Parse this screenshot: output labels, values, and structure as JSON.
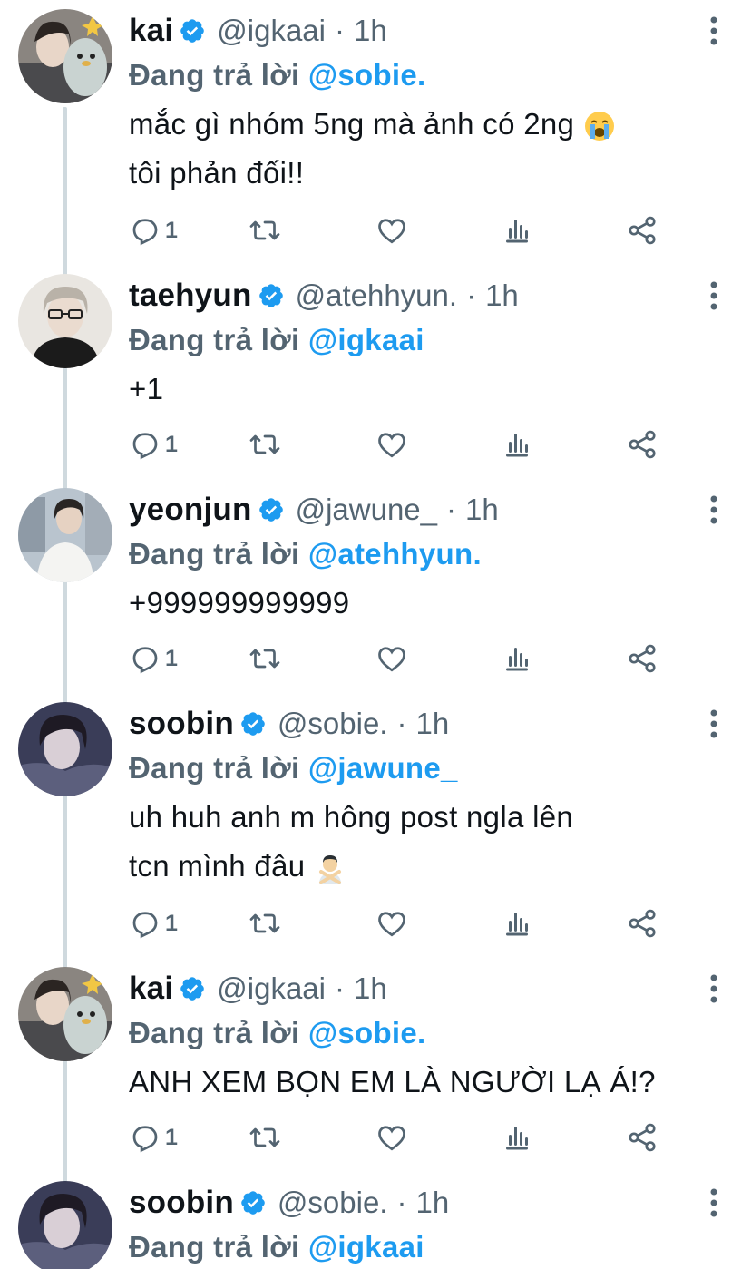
{
  "tweets": [
    {
      "name": "kai",
      "handle": "@igkaai",
      "time": "1h",
      "reply_prefix": "Đang trả lời",
      "reply_to": "@sobie.",
      "lines": [
        "mắc gì nhóm 5ng mà ảnh có 2ng",
        "tôi phản đối!!"
      ],
      "emoji": "crying-face",
      "reply_count": "1"
    },
    {
      "name": "taehyun",
      "handle": "@atehhyun.",
      "time": "1h",
      "reply_prefix": "Đang trả lời",
      "reply_to": "@igkaai",
      "lines": [
        "+1"
      ],
      "reply_count": "1"
    },
    {
      "name": "yeonjun",
      "handle": "@jawune_",
      "time": "1h",
      "reply_prefix": "Đang trả lời",
      "reply_to": "@atehhyun.",
      "lines": [
        "+999999999999"
      ],
      "reply_count": "1"
    },
    {
      "name": "soobin",
      "handle": "@sobie.",
      "time": "1h",
      "reply_prefix": "Đang trả lời",
      "reply_to": "@jawune_",
      "lines": [
        "uh huh anh m hông post ngla lên",
        "tcn mình đâu"
      ],
      "emoji": "person-gesturing-no",
      "reply_count": "1"
    },
    {
      "name": "kai",
      "handle": "@igkaai",
      "time": "1h",
      "reply_prefix": "Đang trả lời",
      "reply_to": "@sobie.",
      "lines": [
        "ANH XEM BỌN EM LÀ NGƯỜI LẠ Á!?"
      ],
      "reply_count": "1"
    },
    {
      "name": "soobin",
      "handle": "@sobie.",
      "time": "1h",
      "reply_prefix": "Đang trả lời",
      "reply_to": "@igkaai"
    }
  ],
  "dot_separator": "·",
  "colors": {
    "accent": "#1d9bf0",
    "muted": "#536471",
    "text": "#0f1419",
    "thread_line": "#cfd9de"
  },
  "icons": {
    "verified": "verified-badge-icon",
    "more": "more-vertical-icon",
    "reply": "reply-icon",
    "retweet": "retweet-icon",
    "like": "like-icon",
    "analytics": "analytics-icon",
    "share": "share-icon"
  }
}
